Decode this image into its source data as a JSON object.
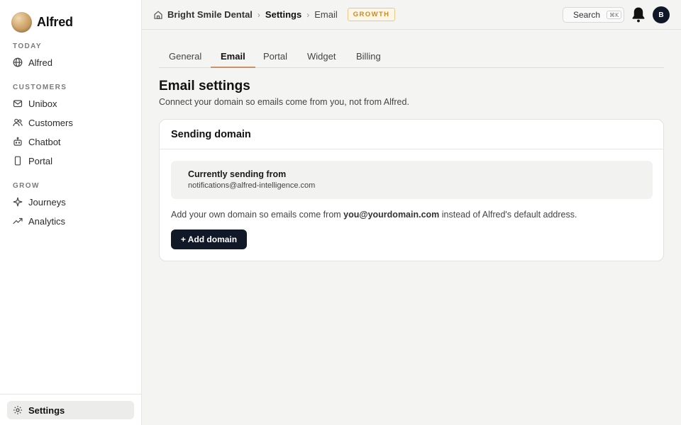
{
  "app": {
    "name": "Alfred"
  },
  "sidebar": {
    "sections": {
      "today": "TODAY",
      "customers": "CUSTOMERS",
      "grow": "GROW"
    },
    "items": {
      "alfred": {
        "label": "Alfred",
        "icon": "globe-icon"
      },
      "unibox": {
        "label": "Unibox",
        "icon": "inbox-icon"
      },
      "customers": {
        "label": "Customers",
        "icon": "users-icon"
      },
      "chatbot": {
        "label": "Chatbot",
        "icon": "bot-icon"
      },
      "portal": {
        "label": "Portal",
        "icon": "phone-icon"
      },
      "journeys": {
        "label": "Journeys",
        "icon": "sparkle-icon"
      },
      "analytics": {
        "label": "Analytics",
        "icon": "trend-icon"
      },
      "settings": {
        "label": "Settings",
        "icon": "gear-icon",
        "active": true
      }
    }
  },
  "header": {
    "breadcrumb": [
      "Bright Smile Dental",
      "Settings",
      "Email"
    ],
    "plan_badge": "GROWTH",
    "search_label": "Search",
    "search_shortcut": "⌘K",
    "avatar_initial": "B"
  },
  "tabs": [
    {
      "label": "General"
    },
    {
      "label": "Email",
      "active": true
    },
    {
      "label": "Portal"
    },
    {
      "label": "Widget"
    },
    {
      "label": "Billing"
    }
  ],
  "page": {
    "title": "Email settings",
    "subtitle": "Connect your domain so emails come from you, not from Alfred."
  },
  "sending_domain": {
    "card_title": "Sending domain",
    "current_label": "Currently sending from",
    "current_email": "notifications@alfred-intelligence.com",
    "hint_prefix": "Add your own domain so emails come from ",
    "hint_address": "you@yourdomain.com",
    "hint_suffix": " instead of Alfred's default address.",
    "add_button": "+ Add domain"
  },
  "colors": {
    "accent_underline": "#c9936a",
    "badge_text": "#c98a1f",
    "primary_button": "#111827"
  }
}
